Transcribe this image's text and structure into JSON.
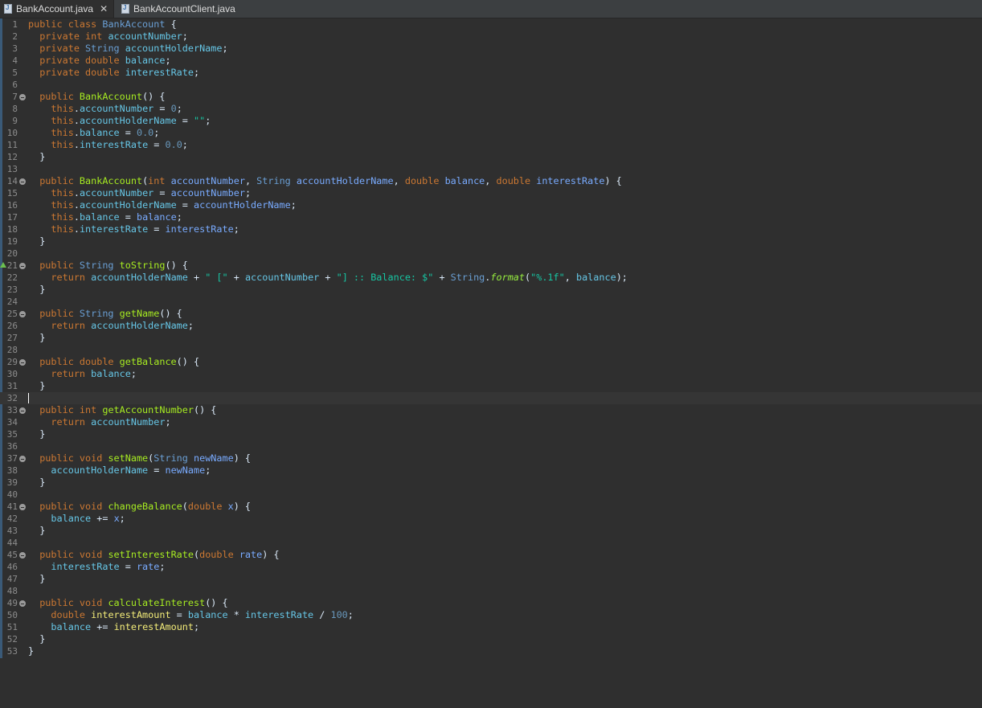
{
  "tabs": [
    {
      "label": "BankAccount.java",
      "active": true,
      "icon": "java-file-icon",
      "close": "✕"
    },
    {
      "label": "BankAccountClient.java",
      "active": false,
      "icon": "java-file-icon"
    }
  ],
  "colors": {
    "background": "#2f2f2f",
    "keyword": "#cc7832",
    "field": "#66c6e6",
    "type": "#6a9fd4",
    "method": "#a7ec21",
    "string": "#17c6a3",
    "number": "#6897bb",
    "local": "#f3ec79"
  },
  "editor": {
    "current_line": 32,
    "lines": [
      {
        "n": "1",
        "fold": false,
        "tokens": [
          [
            "kw",
            "public class "
          ],
          [
            "cls",
            "BankAccount"
          ],
          [
            "op",
            " {"
          ]
        ]
      },
      {
        "n": "2",
        "fold": false,
        "tokens": [
          [
            "kw",
            "  private int "
          ],
          [
            "fld",
            "accountNumber"
          ],
          [
            "op",
            ";"
          ]
        ]
      },
      {
        "n": "3",
        "fold": false,
        "tokens": [
          [
            "kw",
            "  private "
          ],
          [
            "ty",
            "String "
          ],
          [
            "fld",
            "accountHolderName"
          ],
          [
            "op",
            ";"
          ]
        ]
      },
      {
        "n": "4",
        "fold": false,
        "tokens": [
          [
            "kw",
            "  private double "
          ],
          [
            "fld",
            "balance"
          ],
          [
            "op",
            ";"
          ]
        ]
      },
      {
        "n": "5",
        "fold": false,
        "tokens": [
          [
            "kw",
            "  private double "
          ],
          [
            "fld",
            "interestRate"
          ],
          [
            "op",
            ";"
          ]
        ]
      },
      {
        "n": "6",
        "fold": false,
        "tokens": []
      },
      {
        "n": "7",
        "fold": true,
        "tokens": [
          [
            "kw",
            "  public "
          ],
          [
            "mth",
            "BankAccount"
          ],
          [
            "op",
            "() {"
          ]
        ]
      },
      {
        "n": "8",
        "fold": false,
        "tokens": [
          [
            "kw",
            "    this"
          ],
          [
            "op",
            "."
          ],
          [
            "fld",
            "accountNumber"
          ],
          [
            "op",
            " = "
          ],
          [
            "num",
            "0"
          ],
          [
            "op",
            ";"
          ]
        ]
      },
      {
        "n": "9",
        "fold": false,
        "tokens": [
          [
            "kw",
            "    this"
          ],
          [
            "op",
            "."
          ],
          [
            "fld",
            "accountHolderName"
          ],
          [
            "op",
            " = "
          ],
          [
            "str",
            "\"\""
          ],
          [
            "op",
            ";"
          ]
        ]
      },
      {
        "n": "10",
        "fold": false,
        "tokens": [
          [
            "kw",
            "    this"
          ],
          [
            "op",
            "."
          ],
          [
            "fld",
            "balance"
          ],
          [
            "op",
            " = "
          ],
          [
            "num",
            "0.0"
          ],
          [
            "op",
            ";"
          ]
        ]
      },
      {
        "n": "11",
        "fold": false,
        "tokens": [
          [
            "kw",
            "    this"
          ],
          [
            "op",
            "."
          ],
          [
            "fld",
            "interestRate"
          ],
          [
            "op",
            " = "
          ],
          [
            "num",
            "0.0"
          ],
          [
            "op",
            ";"
          ]
        ]
      },
      {
        "n": "12",
        "fold": false,
        "tokens": [
          [
            "op",
            "  }"
          ]
        ]
      },
      {
        "n": "13",
        "fold": false,
        "tokens": []
      },
      {
        "n": "14",
        "fold": true,
        "tokens": [
          [
            "kw",
            "  public "
          ],
          [
            "mth",
            "BankAccount"
          ],
          [
            "op",
            "("
          ],
          [
            "kw",
            "int "
          ],
          [
            "prm",
            "accountNumber"
          ],
          [
            "op",
            ", "
          ],
          [
            "ty",
            "String "
          ],
          [
            "prm",
            "accountHolderName"
          ],
          [
            "op",
            ", "
          ],
          [
            "kw",
            "double "
          ],
          [
            "prm",
            "balance"
          ],
          [
            "op",
            ", "
          ],
          [
            "kw",
            "double "
          ],
          [
            "prm",
            "interestRate"
          ],
          [
            "op",
            ") {"
          ]
        ]
      },
      {
        "n": "15",
        "fold": false,
        "tokens": [
          [
            "kw",
            "    this"
          ],
          [
            "op",
            "."
          ],
          [
            "fld",
            "accountNumber"
          ],
          [
            "op",
            " = "
          ],
          [
            "prm",
            "accountNumber"
          ],
          [
            "op",
            ";"
          ]
        ]
      },
      {
        "n": "16",
        "fold": false,
        "tokens": [
          [
            "kw",
            "    this"
          ],
          [
            "op",
            "."
          ],
          [
            "fld",
            "accountHolderName"
          ],
          [
            "op",
            " = "
          ],
          [
            "prm",
            "accountHolderName"
          ],
          [
            "op",
            ";"
          ]
        ]
      },
      {
        "n": "17",
        "fold": false,
        "tokens": [
          [
            "kw",
            "    this"
          ],
          [
            "op",
            "."
          ],
          [
            "fld",
            "balance"
          ],
          [
            "op",
            " = "
          ],
          [
            "prm",
            "balance"
          ],
          [
            "op",
            ";"
          ]
        ]
      },
      {
        "n": "18",
        "fold": false,
        "tokens": [
          [
            "kw",
            "    this"
          ],
          [
            "op",
            "."
          ],
          [
            "fld",
            "interestRate"
          ],
          [
            "op",
            " = "
          ],
          [
            "prm",
            "interestRate"
          ],
          [
            "op",
            ";"
          ]
        ]
      },
      {
        "n": "19",
        "fold": false,
        "tokens": [
          [
            "op",
            "  }"
          ]
        ]
      },
      {
        "n": "20",
        "fold": false,
        "tokens": []
      },
      {
        "n": "21",
        "fold": true,
        "override": true,
        "tokens": [
          [
            "kw",
            "  public "
          ],
          [
            "ty",
            "String "
          ],
          [
            "mth",
            "toString"
          ],
          [
            "op",
            "() {"
          ]
        ]
      },
      {
        "n": "22",
        "fold": false,
        "tokens": [
          [
            "kw",
            "    return "
          ],
          [
            "fld",
            "accountHolderName"
          ],
          [
            "op",
            " + "
          ],
          [
            "str",
            "\" [\""
          ],
          [
            "op",
            " + "
          ],
          [
            "fld",
            "accountNumber"
          ],
          [
            "op",
            " + "
          ],
          [
            "str",
            "\"] :: Balance: $\""
          ],
          [
            "op",
            " + "
          ],
          [
            "ty",
            "String"
          ],
          [
            "op",
            "."
          ],
          [
            "smth",
            "format"
          ],
          [
            "op",
            "("
          ],
          [
            "str",
            "\"%.1f\""
          ],
          [
            "op",
            ", "
          ],
          [
            "fld",
            "balance"
          ],
          [
            "op",
            ");"
          ]
        ]
      },
      {
        "n": "23",
        "fold": false,
        "tokens": [
          [
            "op",
            "  }"
          ]
        ]
      },
      {
        "n": "24",
        "fold": false,
        "tokens": []
      },
      {
        "n": "25",
        "fold": true,
        "tokens": [
          [
            "kw",
            "  public "
          ],
          [
            "ty",
            "String "
          ],
          [
            "mth",
            "getName"
          ],
          [
            "op",
            "() {"
          ]
        ]
      },
      {
        "n": "26",
        "fold": false,
        "tokens": [
          [
            "kw",
            "    return "
          ],
          [
            "fld",
            "accountHolderName"
          ],
          [
            "op",
            ";"
          ]
        ]
      },
      {
        "n": "27",
        "fold": false,
        "tokens": [
          [
            "op",
            "  }"
          ]
        ]
      },
      {
        "n": "28",
        "fold": false,
        "tokens": []
      },
      {
        "n": "29",
        "fold": true,
        "tokens": [
          [
            "kw",
            "  public double "
          ],
          [
            "mth",
            "getBalance"
          ],
          [
            "op",
            "() {"
          ]
        ]
      },
      {
        "n": "30",
        "fold": false,
        "tokens": [
          [
            "kw",
            "    return "
          ],
          [
            "fld",
            "balance"
          ],
          [
            "op",
            ";"
          ]
        ]
      },
      {
        "n": "31",
        "fold": false,
        "tokens": [
          [
            "op",
            "  }"
          ]
        ]
      },
      {
        "n": "32",
        "fold": false,
        "tokens": []
      },
      {
        "n": "33",
        "fold": true,
        "tokens": [
          [
            "kw",
            "  public int "
          ],
          [
            "mth",
            "getAccountNumber"
          ],
          [
            "op",
            "() {"
          ]
        ]
      },
      {
        "n": "34",
        "fold": false,
        "tokens": [
          [
            "kw",
            "    return "
          ],
          [
            "fld",
            "accountNumber"
          ],
          [
            "op",
            ";"
          ]
        ]
      },
      {
        "n": "35",
        "fold": false,
        "tokens": [
          [
            "op",
            "  }"
          ]
        ]
      },
      {
        "n": "36",
        "fold": false,
        "tokens": []
      },
      {
        "n": "37",
        "fold": true,
        "tokens": [
          [
            "kw",
            "  public void "
          ],
          [
            "mth",
            "setName"
          ],
          [
            "op",
            "("
          ],
          [
            "ty",
            "String "
          ],
          [
            "prm",
            "newName"
          ],
          [
            "op",
            ") {"
          ]
        ]
      },
      {
        "n": "38",
        "fold": false,
        "tokens": [
          [
            "fld",
            "    accountHolderName"
          ],
          [
            "op",
            " = "
          ],
          [
            "prm",
            "newName"
          ],
          [
            "op",
            ";"
          ]
        ]
      },
      {
        "n": "39",
        "fold": false,
        "tokens": [
          [
            "op",
            "  }"
          ]
        ]
      },
      {
        "n": "40",
        "fold": false,
        "tokens": []
      },
      {
        "n": "41",
        "fold": true,
        "tokens": [
          [
            "kw",
            "  public void "
          ],
          [
            "mth",
            "changeBalance"
          ],
          [
            "op",
            "("
          ],
          [
            "kw",
            "double "
          ],
          [
            "prm",
            "x"
          ],
          [
            "op",
            ") {"
          ]
        ]
      },
      {
        "n": "42",
        "fold": false,
        "tokens": [
          [
            "fld",
            "    balance"
          ],
          [
            "op",
            " += "
          ],
          [
            "prm",
            "x"
          ],
          [
            "op",
            ";"
          ]
        ]
      },
      {
        "n": "43",
        "fold": false,
        "tokens": [
          [
            "op",
            "  }"
          ]
        ]
      },
      {
        "n": "44",
        "fold": false,
        "tokens": []
      },
      {
        "n": "45",
        "fold": true,
        "tokens": [
          [
            "kw",
            "  public void "
          ],
          [
            "mth",
            "setInterestRate"
          ],
          [
            "op",
            "("
          ],
          [
            "kw",
            "double "
          ],
          [
            "prm",
            "rate"
          ],
          [
            "op",
            ") {"
          ]
        ]
      },
      {
        "n": "46",
        "fold": false,
        "tokens": [
          [
            "fld",
            "    interestRate"
          ],
          [
            "op",
            " = "
          ],
          [
            "prm",
            "rate"
          ],
          [
            "op",
            ";"
          ]
        ]
      },
      {
        "n": "47",
        "fold": false,
        "tokens": [
          [
            "op",
            "  }"
          ]
        ]
      },
      {
        "n": "48",
        "fold": false,
        "tokens": []
      },
      {
        "n": "49",
        "fold": true,
        "tokens": [
          [
            "kw",
            "  public void "
          ],
          [
            "mth",
            "calculateInterest"
          ],
          [
            "op",
            "() {"
          ]
        ]
      },
      {
        "n": "50",
        "fold": false,
        "tokens": [
          [
            "kw",
            "    double "
          ],
          [
            "loc",
            "interestAmount"
          ],
          [
            "op",
            " = "
          ],
          [
            "fld",
            "balance"
          ],
          [
            "op",
            " * "
          ],
          [
            "fld",
            "interestRate"
          ],
          [
            "op",
            " / "
          ],
          [
            "num",
            "100"
          ],
          [
            "op",
            ";"
          ]
        ]
      },
      {
        "n": "51",
        "fold": false,
        "tokens": [
          [
            "fld",
            "    balance"
          ],
          [
            "op",
            " += "
          ],
          [
            "loc",
            "interestAmount"
          ],
          [
            "op",
            ";"
          ]
        ]
      },
      {
        "n": "52",
        "fold": false,
        "tokens": [
          [
            "op",
            "  }"
          ]
        ]
      },
      {
        "n": "53",
        "fold": false,
        "tokens": [
          [
            "op",
            "}"
          ]
        ]
      }
    ]
  }
}
